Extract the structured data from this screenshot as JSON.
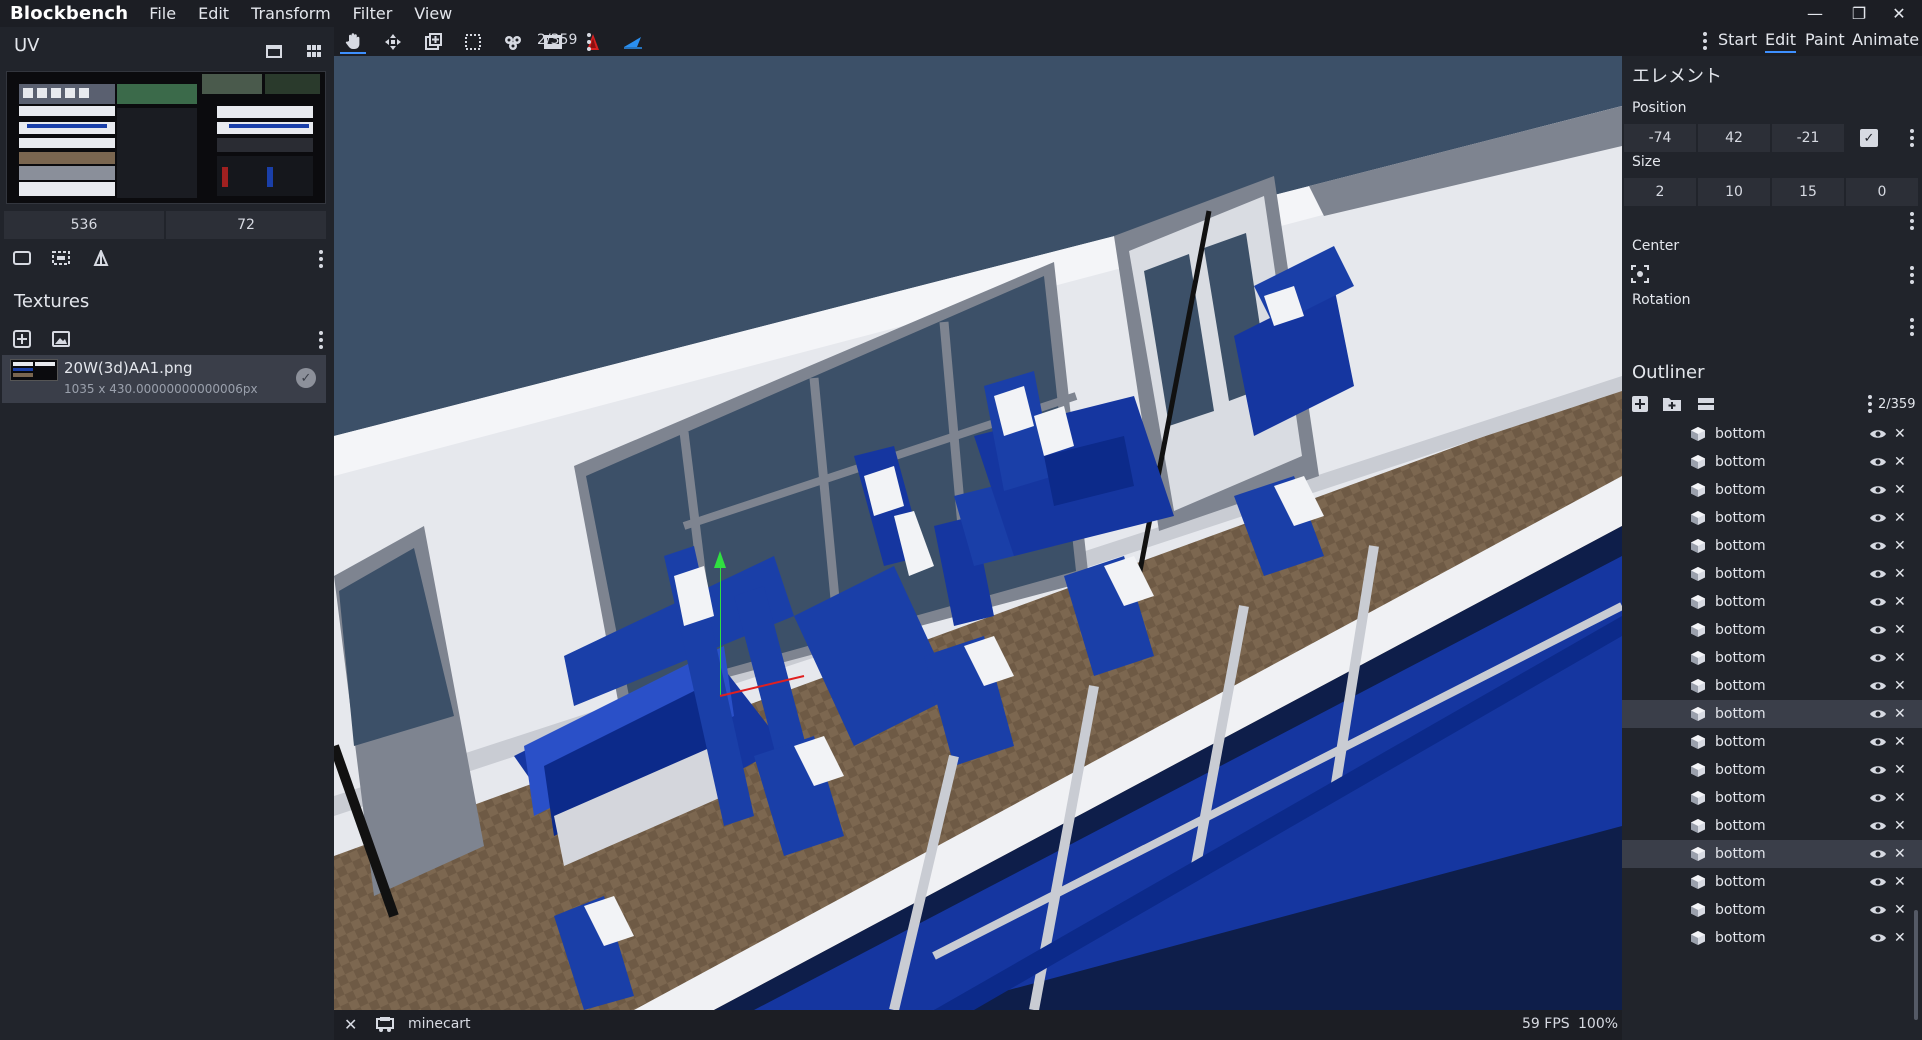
{
  "app": {
    "title": "Blockbench"
  },
  "menu": {
    "items": [
      "File",
      "Edit",
      "Transform",
      "Filter",
      "View"
    ]
  },
  "window_controls": {
    "minimize": "—",
    "restore": "❐",
    "close": "✕"
  },
  "modes": {
    "start": "Start",
    "edit": "Edit",
    "paint": "Paint",
    "animate": "Animate"
  },
  "toolbar": {
    "selection_count": "2/359"
  },
  "uv": {
    "title": "UV",
    "fields": [
      "536",
      "72"
    ]
  },
  "textures": {
    "title": "Textures",
    "items": [
      {
        "name": "20W(3d)AA1.png",
        "size": "1035 x 430.00000000000006px"
      }
    ]
  },
  "element": {
    "title": "エレメント",
    "position_label": "Position",
    "position": [
      "-74",
      "42",
      "-21"
    ],
    "size_label": "Size",
    "size": [
      "2",
      "10",
      "15",
      "0"
    ],
    "center_label": "Center",
    "rotation_label": "Rotation"
  },
  "outliner": {
    "title": "Outliner",
    "count": "2/359",
    "rows": [
      {
        "label": "bottom",
        "selected": false
      },
      {
        "label": "bottom",
        "selected": false
      },
      {
        "label": "bottom",
        "selected": false
      },
      {
        "label": "bottom",
        "selected": false
      },
      {
        "label": "bottom",
        "selected": false
      },
      {
        "label": "bottom",
        "selected": false
      },
      {
        "label": "bottom",
        "selected": false
      },
      {
        "label": "bottom",
        "selected": false
      },
      {
        "label": "bottom",
        "selected": false
      },
      {
        "label": "bottom",
        "selected": false
      },
      {
        "label": "bottom",
        "selected": true
      },
      {
        "label": "bottom",
        "selected": false
      },
      {
        "label": "bottom",
        "selected": false
      },
      {
        "label": "bottom",
        "selected": false
      },
      {
        "label": "bottom",
        "selected": false
      },
      {
        "label": "bottom",
        "selected": true
      },
      {
        "label": "bottom",
        "selected": false
      },
      {
        "label": "bottom",
        "selected": false
      },
      {
        "label": "bottom",
        "selected": false
      }
    ]
  },
  "status": {
    "model_name": "minecart",
    "fps": "59 FPS",
    "zoom": "100%"
  },
  "colors": {
    "accent": "#3e90ff",
    "panel": "#21242b",
    "seat_blue": "#1a3fa8",
    "floor": "#7a6650",
    "wall": "#e8eaef",
    "sky": "#3c5068"
  }
}
